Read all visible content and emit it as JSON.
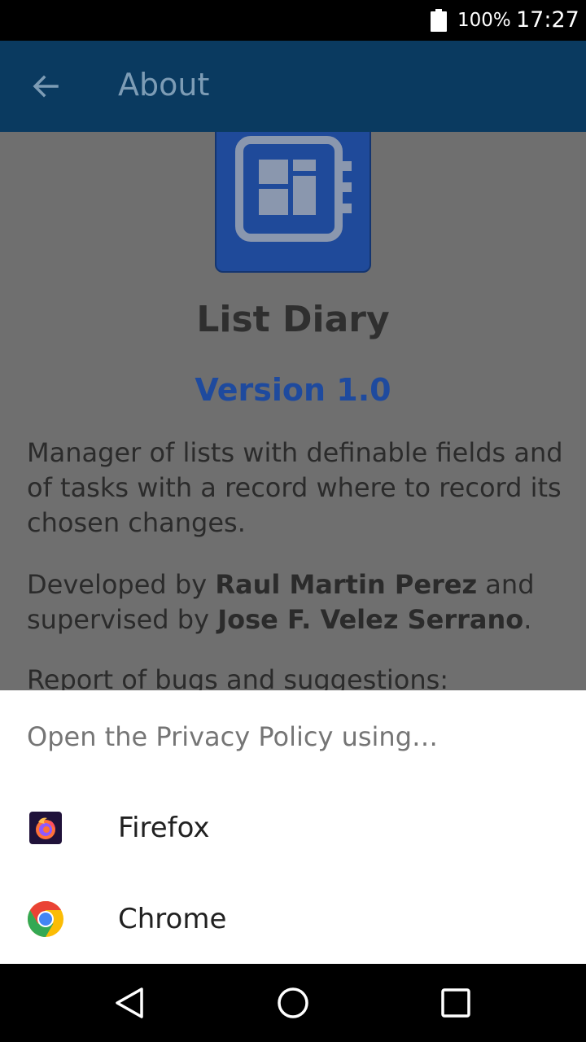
{
  "status_bar": {
    "battery": "100%",
    "time": "17:27"
  },
  "app_bar": {
    "title": "About"
  },
  "about": {
    "app_name": "List Diary",
    "version": "Version 1.0",
    "description": "Manager of lists with definable fields and of tasks with a record where to record its chosen changes.",
    "dev_prefix": "Developed by ",
    "developer": "Raul Martin Perez",
    "dev_middle": " and supervised by ",
    "supervisor": "Jose F. Velez Serrano",
    "dev_suffix": ".",
    "report": "Report of bugs and suggestions:"
  },
  "chooser": {
    "title": "Open the Privacy Policy using…",
    "apps": [
      {
        "label": "Firefox",
        "icon": "firefox-icon"
      },
      {
        "label": "Chrome",
        "icon": "chrome-icon"
      }
    ]
  },
  "nav": {
    "icons": [
      "back-triangle-icon",
      "home-circle-icon",
      "recents-square-icon"
    ]
  },
  "colors": {
    "app_bar": "#0a3a60",
    "accent": "#1e4a9e",
    "scrim_content": "#6f6f6f"
  }
}
